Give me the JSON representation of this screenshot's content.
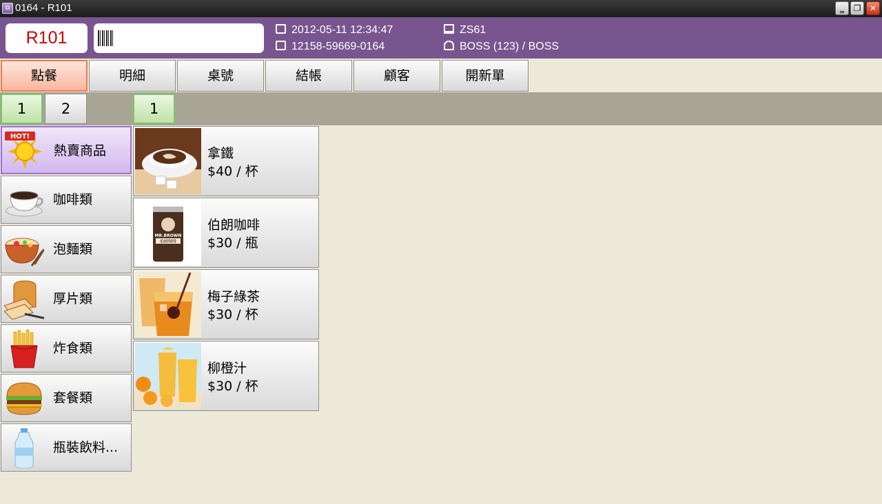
{
  "window": {
    "title": "0164 - R101",
    "min_glyph": "‗",
    "max_glyph": "❐",
    "close_glyph": "✕"
  },
  "header": {
    "table_no": "R101",
    "barcode_placeholder": "",
    "datetime": "2012-05-11 12:34:47",
    "order_no": "12158-59669-0164",
    "station": "ZS61",
    "user": "BOSS (123) / BOSS",
    "accent": "#78558f"
  },
  "tabs": [
    {
      "label": "點餐",
      "active": true
    },
    {
      "label": "明細"
    },
    {
      "label": "桌號"
    },
    {
      "label": "結帳"
    },
    {
      "label": "顧客"
    },
    {
      "label": "開新單"
    }
  ],
  "category_pages": [
    "1",
    "2"
  ],
  "product_pages": [
    "1"
  ],
  "categories": [
    {
      "label": "熱賣商品",
      "icon": "hot-sun-icon",
      "badge": "HOT!"
    },
    {
      "label": "咖啡類",
      "icon": "coffee-cup-icon"
    },
    {
      "label": "泡麵類",
      "icon": "noodle-bowl-icon"
    },
    {
      "label": "厚片類",
      "icon": "toast-bread-icon"
    },
    {
      "label": "炸食類",
      "icon": "fries-icon"
    },
    {
      "label": "套餐類",
      "icon": "burger-icon"
    },
    {
      "label": "瓶裝飲料...",
      "icon": "water-bottle-icon"
    }
  ],
  "products": [
    {
      "name": "拿鐵",
      "price": "$40 / 杯",
      "image": "latte-image"
    },
    {
      "name": "伯朗咖啡",
      "price": "$30 / 瓶",
      "image": "brown-coffee-can-image",
      "can_brand": "MR.BROWN",
      "can_label": "伯朗咖啡"
    },
    {
      "name": "梅子綠茶",
      "price": "$30 / 杯",
      "image": "plum-green-tea-image"
    },
    {
      "name": "柳橙汁",
      "price": "$30 / 杯",
      "image": "orange-juice-image"
    }
  ]
}
